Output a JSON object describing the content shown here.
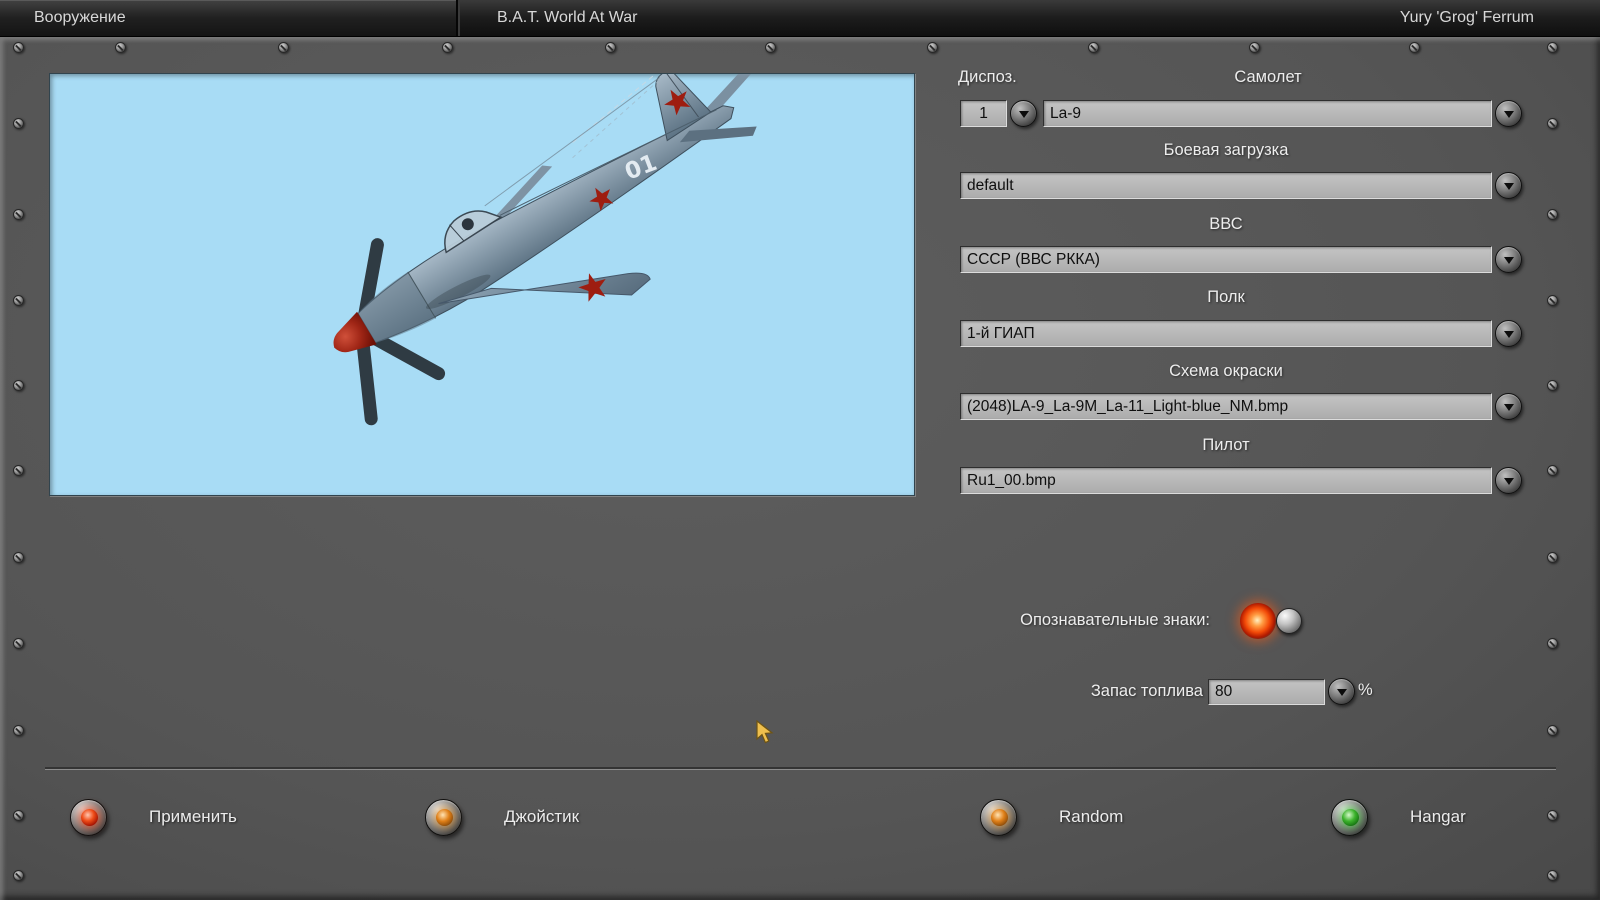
{
  "titlebar": {
    "tab_armament": "Вооружение",
    "tab_bat": "B.A.T. World At War",
    "player": "Yury 'Grog' Ferrum"
  },
  "preview": {
    "marking_number": "01"
  },
  "fields": {
    "dispos": {
      "label": "Диспоз.",
      "value": "1"
    },
    "aircraft": {
      "label": "Самолет",
      "value": "La-9"
    },
    "loadout": {
      "label": "Боевая загрузка",
      "value": "default"
    },
    "airforce": {
      "label": "ВВС",
      "value": "СССР (ВВС РККА)"
    },
    "regiment": {
      "label": "Полк",
      "value": "1-й ГИАП"
    },
    "skin": {
      "label": "Схема окраски",
      "value": "(2048)LA-9_La-9M_La-11_Light-blue_NM.bmp"
    },
    "pilot": {
      "label": "Пилот",
      "value": "Ru1_00.bmp"
    }
  },
  "markings_toggle": {
    "label": "Опознавательные знаки:",
    "state": "on"
  },
  "fuel": {
    "label": "Запас топлива",
    "value": "80",
    "unit": "%"
  },
  "actions": [
    {
      "label": "Применить",
      "lamp_color": "#ef4c18"
    },
    {
      "label": "Джойстик",
      "lamp_color": "#e08018"
    },
    {
      "label": "Random",
      "lamp_color": "#e08018"
    },
    {
      "label": "Hangar",
      "lamp_color": "#3cb32c"
    }
  ],
  "colors": {
    "panel": "#585858",
    "combo": "#b8b8b8",
    "sky": "#a8dcf5",
    "star_red": "#9e1d10"
  }
}
